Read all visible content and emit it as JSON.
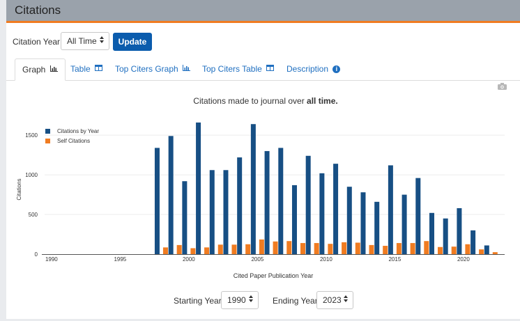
{
  "header": {
    "title": "Citations"
  },
  "controls": {
    "citation_year_label": "Citation Year",
    "citation_year_value": "All Time",
    "update_label": "Update"
  },
  "tabs": [
    {
      "label": "Graph",
      "icon": "bar-chart-icon"
    },
    {
      "label": "Table",
      "icon": "table-icon"
    },
    {
      "label": "Top Citers Graph",
      "icon": "bar-chart-icon"
    },
    {
      "label": "Top Citers Table",
      "icon": "table-icon"
    },
    {
      "label": "Description",
      "icon": "info-icon"
    }
  ],
  "chart_title": {
    "prefix": "Citations made to journal over ",
    "emphasis": "all time."
  },
  "range": {
    "starting_label": "Starting Year",
    "starting_value": "1990",
    "ending_label": "Ending Year",
    "ending_value": "2023"
  },
  "colors": {
    "citations": "#174f84",
    "self": "#f07c21",
    "accent": "#0b5cad"
  },
  "chart_data": {
    "type": "bar",
    "title": "Citations made to journal over all time.",
    "xlabel": "Cited Paper Publication Year",
    "ylabel": "Citations",
    "xlim": [
      1989.5,
      2023
    ],
    "ylim": [
      0,
      1800
    ],
    "x_ticks": [
      "1990",
      "1995",
      "2000",
      "2005",
      "2010",
      "2015",
      "2020"
    ],
    "y_ticks": [
      "0",
      "500",
      "1000",
      "1500"
    ],
    "legend_position": "top-left",
    "grid": true,
    "categories": [
      1998,
      1999,
      2000,
      2001,
      2002,
      2003,
      2004,
      2005,
      2006,
      2007,
      2008,
      2009,
      2010,
      2011,
      2012,
      2013,
      2014,
      2015,
      2016,
      2017,
      2018,
      2019,
      2020,
      2021,
      2022
    ],
    "series": [
      {
        "name": "Citations by Year",
        "values": [
          1340,
          1490,
          920,
          1660,
          1060,
          1060,
          1220,
          1640,
          1300,
          1340,
          870,
          1240,
          1020,
          1140,
          850,
          780,
          660,
          1120,
          750,
          960,
          520,
          450,
          580,
          300,
          110
        ]
      },
      {
        "name": "Self Citations",
        "values": [
          85,
          115,
          75,
          85,
          120,
          120,
          125,
          185,
          160,
          165,
          140,
          140,
          130,
          150,
          145,
          115,
          105,
          140,
          140,
          165,
          90,
          95,
          125,
          60,
          25
        ]
      }
    ]
  }
}
